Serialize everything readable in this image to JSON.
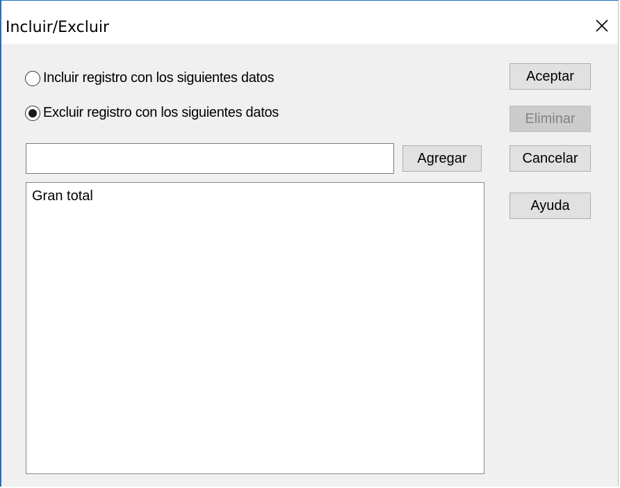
{
  "window": {
    "title": "Incluir/Excluir",
    "close_icon": "close-icon"
  },
  "options": {
    "include_label": "Incluir registro con los siguientes datos",
    "exclude_label": "Excluir registro con los siguientes datos",
    "selected": "exclude"
  },
  "input": {
    "value": "",
    "placeholder": ""
  },
  "buttons": {
    "add": "Agregar",
    "accept": "Aceptar",
    "delete": "Eliminar",
    "cancel": "Cancelar",
    "help": "Ayuda"
  },
  "list": {
    "items": [
      "Gran total"
    ]
  },
  "colors": {
    "window_border": "#1e6fc7",
    "button_face": "#e1e1e1",
    "dialog_bg": "#f0f0f0"
  }
}
